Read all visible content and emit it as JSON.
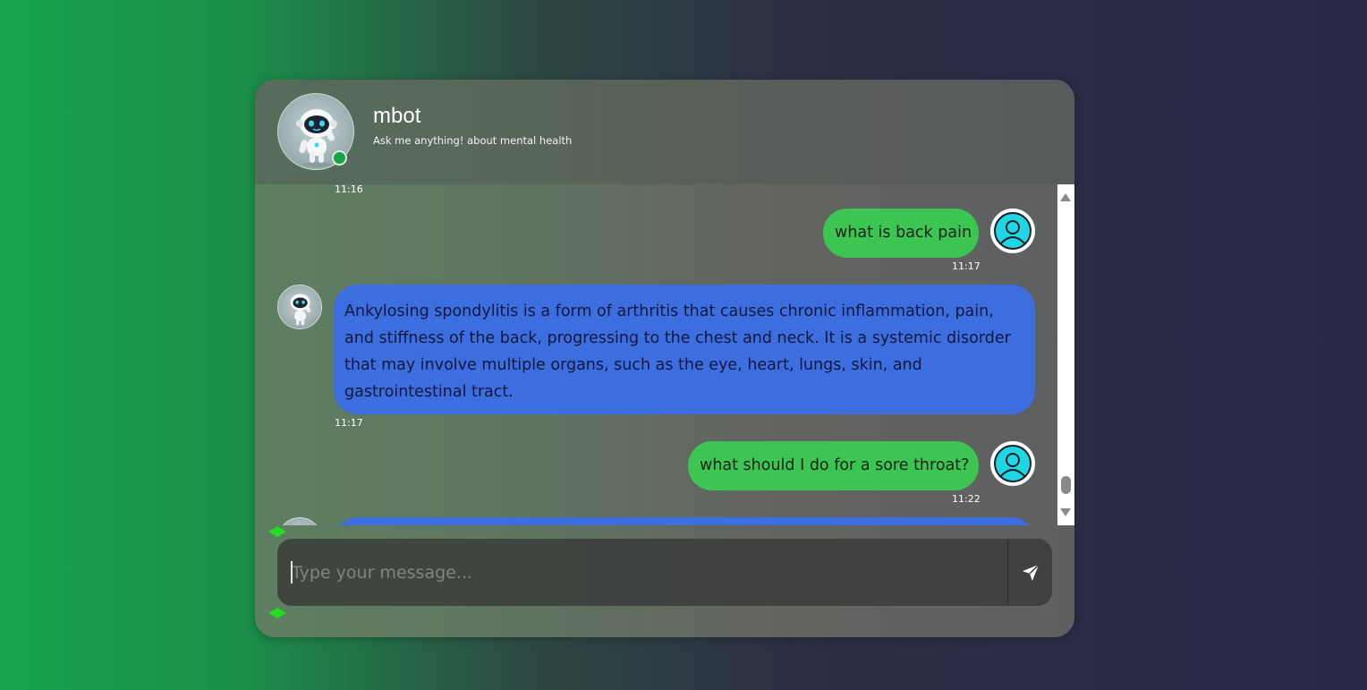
{
  "header": {
    "title": "mbot",
    "subtitle": "Ask me anything! about mental health",
    "status_color": "#16a34a"
  },
  "messages": [
    {
      "sender": "bot",
      "time": "11:16",
      "partial": true
    },
    {
      "sender": "user",
      "text": "what is back pain",
      "time": "11:17"
    },
    {
      "sender": "bot",
      "text": "Ankylosing spondylitis is a form of arthritis that causes chronic inflammation, pain, and stiffness of the back, progressing to the chest and neck. It is a systemic disorder that may involve multiple organs, such as the eye, heart, lungs, skin, and gastrointestinal tract.",
      "time": "11:17"
    },
    {
      "sender": "user",
      "text": "what should I do for a sore throat?",
      "time": "11:22"
    },
    {
      "sender": "bot",
      "partial": true
    }
  ],
  "composer": {
    "placeholder": "Type your message...",
    "send_icon": "send-arrow-icon"
  },
  "colors": {
    "user_bubble": "#3cc553",
    "bot_bubble": "#3d6ee0",
    "user_avatar": "#1fd6e4"
  }
}
